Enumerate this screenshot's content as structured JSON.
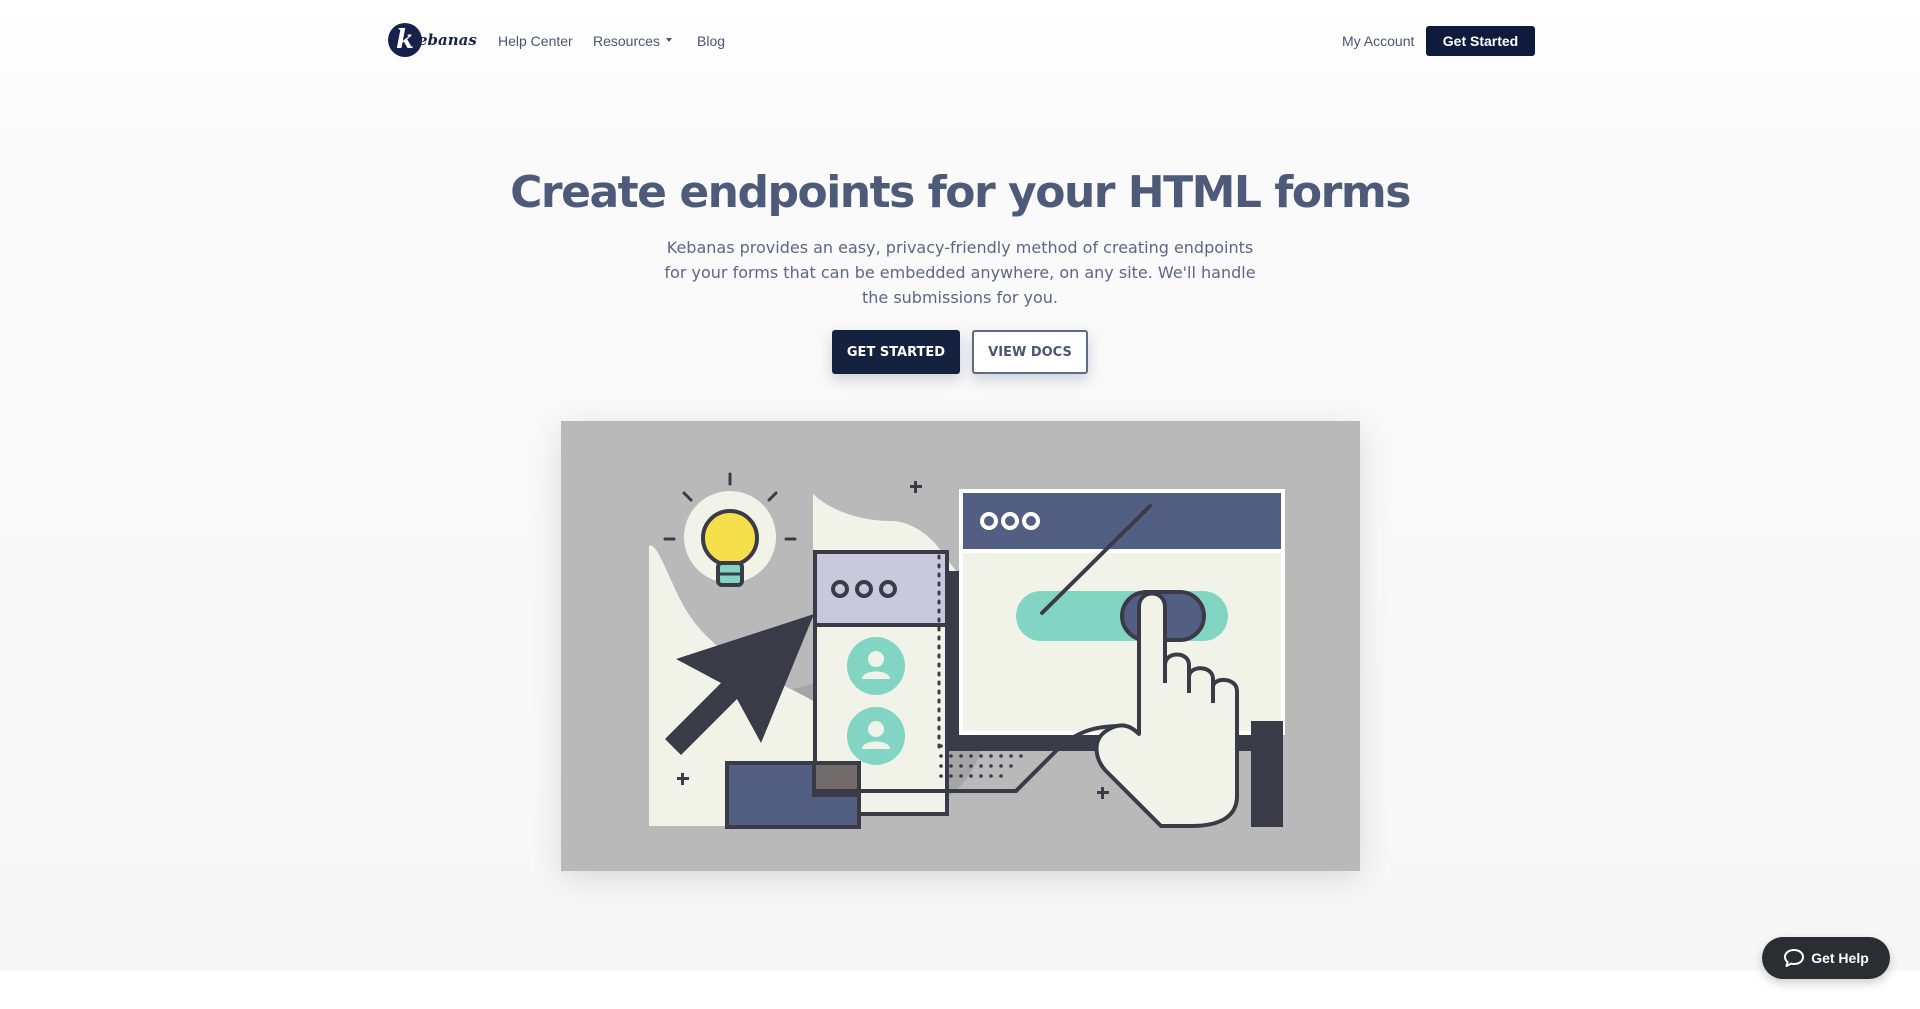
{
  "nav": {
    "logo_letter": "k",
    "logo_text": "ebanas",
    "links": {
      "help_center": "Help Center",
      "resources": "Resources",
      "blog": "Blog",
      "my_account": "My Account"
    },
    "cta": "Get Started"
  },
  "hero": {
    "title": "Create endpoints for your HTML forms",
    "subtitle": "Kebanas provides an easy, privacy-friendly method of creating endpoints for your forms that can be embedded anywhere, on any site. We'll handle the submissions for you.",
    "primary_button": "GET STARTED",
    "secondary_button": "VIEW DOCS"
  },
  "help_widget": {
    "label": "Get Help",
    "icon": "chat-bubble-icon"
  },
  "colors": {
    "navy": "#0f1b3d",
    "heading": "#4e5a79",
    "body_text": "#5d6784",
    "illustration_bg": "#b9b9b9",
    "teal": "#82d5c3",
    "slate": "#535f82",
    "cream": "#f2f3e8",
    "yellow": "#f5e04b"
  }
}
